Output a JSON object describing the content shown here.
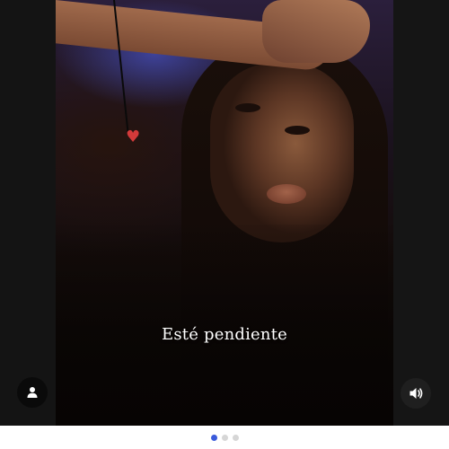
{
  "story": {
    "caption": "Esté pendiente",
    "profile_icon": "person-icon",
    "sound_icon": "speaker-volume-icon",
    "pagination": {
      "count": 3,
      "active_index": 0
    }
  },
  "colors": {
    "stage_background": "#121212",
    "active_dot": "#3b5bdb",
    "inactive_dot": "#d6d6d6"
  }
}
